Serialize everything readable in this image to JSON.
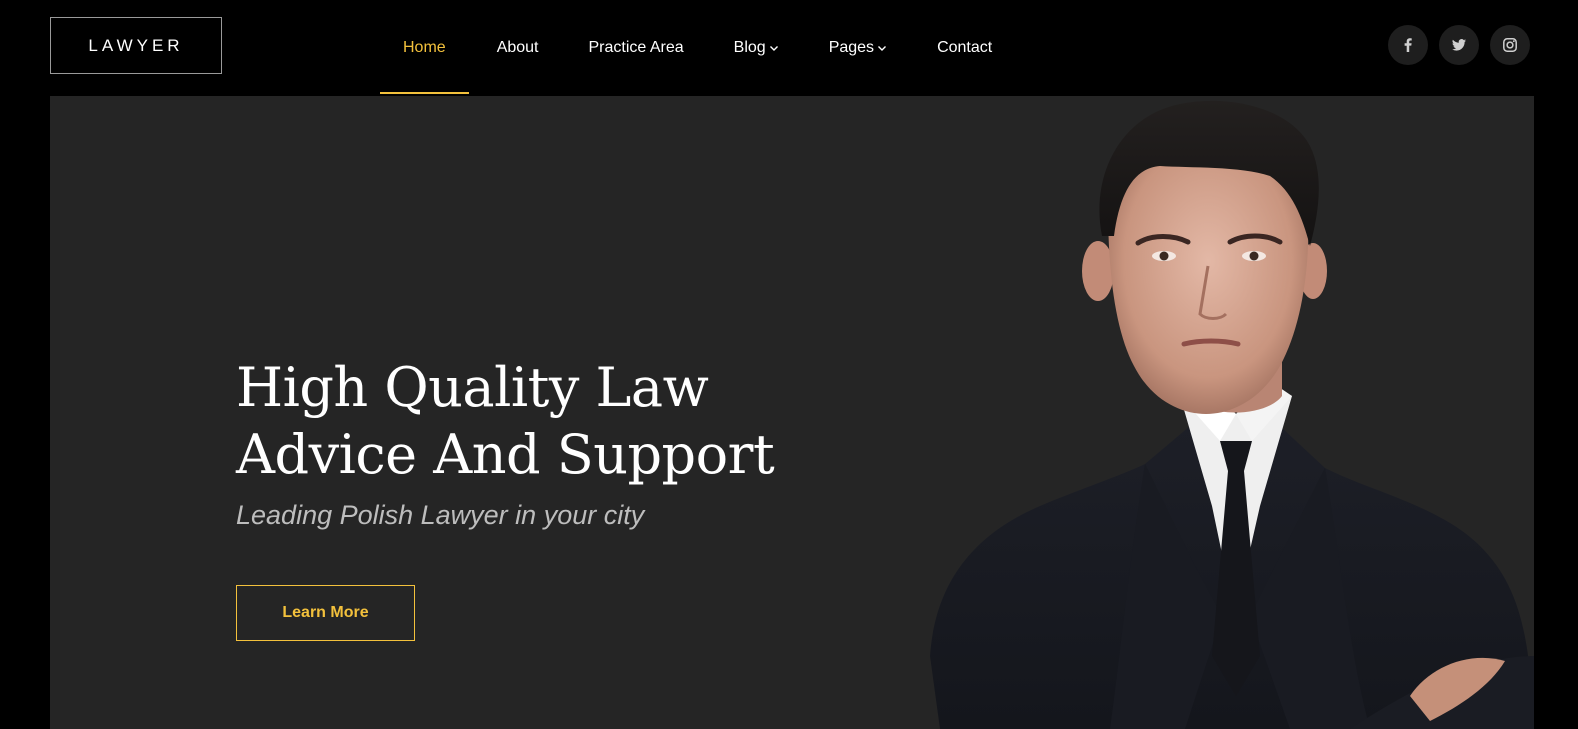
{
  "header": {
    "logo": "LAWYER",
    "nav": [
      {
        "label": "Home",
        "active": true
      },
      {
        "label": "About"
      },
      {
        "label": "Practice Area"
      },
      {
        "label": "Blog",
        "dropdown": true
      },
      {
        "label": "Pages",
        "dropdown": true
      },
      {
        "label": "Contact"
      }
    ],
    "socials": [
      "facebook-icon",
      "twitter-icon",
      "instagram-icon"
    ]
  },
  "hero": {
    "title_line1": "High Quality Law",
    "title_line2": "Advice And Support",
    "subtitle": "Leading Polish Lawyer in your city",
    "cta_label": "Learn More"
  },
  "colors": {
    "accent": "#f3c13c",
    "background": "#000000",
    "hero_bg": "#252525"
  }
}
